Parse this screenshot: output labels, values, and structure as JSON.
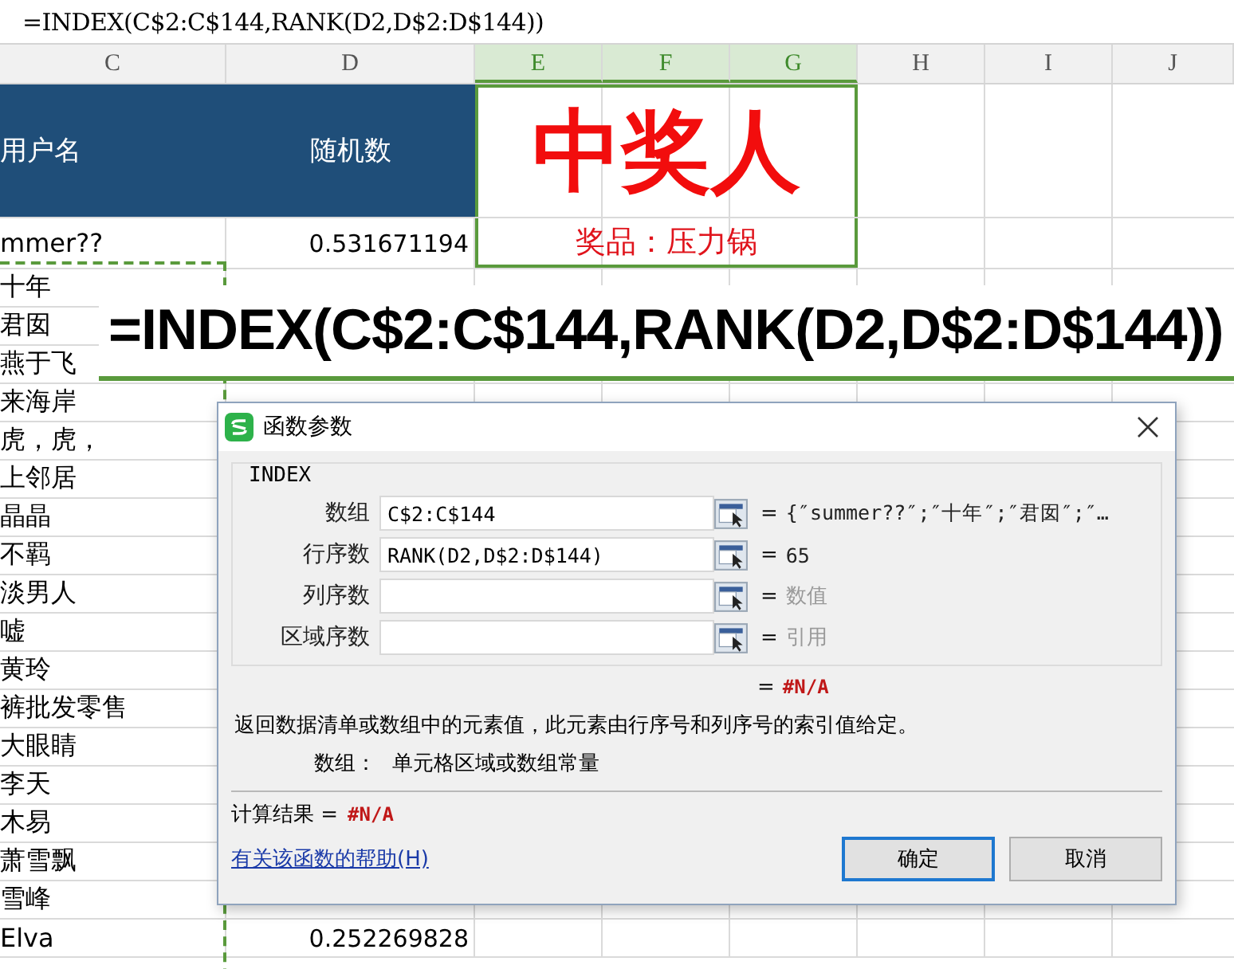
{
  "formula_bar": {
    "text": "=INDEX(C$2:C$144,RANK(D2,D$2:D$144))"
  },
  "columns": [
    {
      "label": "C",
      "selected": false
    },
    {
      "label": "D",
      "selected": false
    },
    {
      "label": "E",
      "selected": true
    },
    {
      "label": "F",
      "selected": true
    },
    {
      "label": "G",
      "selected": true
    },
    {
      "label": "H",
      "selected": false
    },
    {
      "label": "I",
      "selected": false
    },
    {
      "label": "J",
      "selected": false
    }
  ],
  "header_cells": [
    "用户名",
    "随机数"
  ],
  "banner": {
    "title": "中奖人",
    "prize": "奖品：压力锅"
  },
  "rows": [
    {
      "name": "mmer??",
      "value": "0.531671194"
    },
    {
      "name": "十年"
    },
    {
      "name": "君囡"
    },
    {
      "name": "燕于飞"
    },
    {
      "name": "来海岸"
    },
    {
      "name": "虎，虎，"
    },
    {
      "name": "上邻居"
    },
    {
      "name": "晶晶"
    },
    {
      "name": "不羁"
    },
    {
      "name": "淡男人"
    },
    {
      "name": "嘘"
    },
    {
      "name": "黄玲"
    },
    {
      "name": "裤批发零售"
    },
    {
      "name": "大眼睛"
    },
    {
      "name": "李天"
    },
    {
      "name": "木易"
    },
    {
      "name": "萧雪飘"
    },
    {
      "name": "雪峰"
    },
    {
      "name": "Elva",
      "value": "0.252269828"
    }
  ],
  "overlay_formula": "=INDEX(C$2:C$144,RANK(D2,D$2:D$144))",
  "dialog": {
    "title": "函数参数",
    "function_name": "INDEX",
    "args": [
      {
        "label": "数组",
        "value": "C$2:C$144",
        "equals": "=",
        "result": "{″summer??″;″十年″;″君囡″;″…",
        "kind": "value"
      },
      {
        "label": "行序数",
        "value": "RANK(D2,D$2:D$144)",
        "equals": "=",
        "result": "65",
        "kind": "value"
      },
      {
        "label": "列序数",
        "equals": "=",
        "result": "数值",
        "kind": "hint"
      },
      {
        "label": "区域序数",
        "equals": "=",
        "result": "引用",
        "kind": "hint"
      }
    ],
    "formula_result": {
      "equals": "=",
      "value": "#N/A"
    },
    "description": "返回数据清单或数组中的元素值，此元素由行序号和列序号的索引值给定。",
    "arg_help": {
      "label": "数组：",
      "text": "单元格区域或数组常量"
    },
    "computed": {
      "label": "计算结果 =",
      "value": "#N/A"
    },
    "help_link": "有关该函数的帮助(H)",
    "buttons": [
      {
        "label": "确定",
        "default": true
      },
      {
        "label": "取消",
        "default": false
      }
    ]
  }
}
